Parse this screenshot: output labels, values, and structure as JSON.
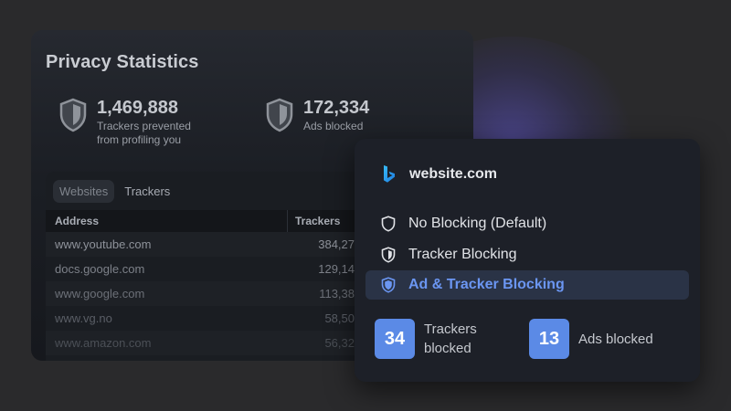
{
  "colors": {
    "accent": "#5b8ae6",
    "selected_text": "#6b96f2",
    "background": "#2a2a2c"
  },
  "privacy_panel": {
    "title": "Privacy Statistics",
    "stats": [
      {
        "value": "1,469,888",
        "label": "Trackers prevented from profiling you",
        "icon": "shield-icon"
      },
      {
        "value": "172,334",
        "label": "Ads blocked",
        "icon": "shield-icon"
      }
    ],
    "tabs": [
      {
        "label": "Websites",
        "active": true
      },
      {
        "label": "Trackers",
        "active": false
      }
    ],
    "table": {
      "headers": [
        "Address",
        "Trackers"
      ],
      "rows": [
        {
          "address": "www.youtube.com",
          "trackers": "384,27"
        },
        {
          "address": "docs.google.com",
          "trackers": "129,14"
        },
        {
          "address": "www.google.com",
          "trackers": "113,38"
        },
        {
          "address": "www.vg.no",
          "trackers": "58,50"
        },
        {
          "address": "www.amazon.com",
          "trackers": "56,32"
        }
      ]
    }
  },
  "popup": {
    "site": {
      "name": "website.com",
      "icon": "bing-logo-icon"
    },
    "options": [
      {
        "label": "No Blocking (Default)",
        "selected": false,
        "icon": "shield-outline-icon"
      },
      {
        "label": "Tracker Blocking",
        "selected": false,
        "icon": "shield-half-icon"
      },
      {
        "label": "Ad & Tracker Blocking",
        "selected": true,
        "icon": "shield-full-icon"
      }
    ],
    "counts": [
      {
        "value": "34",
        "label": "Trackers blocked"
      },
      {
        "value": "13",
        "label": "Ads blocked"
      }
    ]
  }
}
